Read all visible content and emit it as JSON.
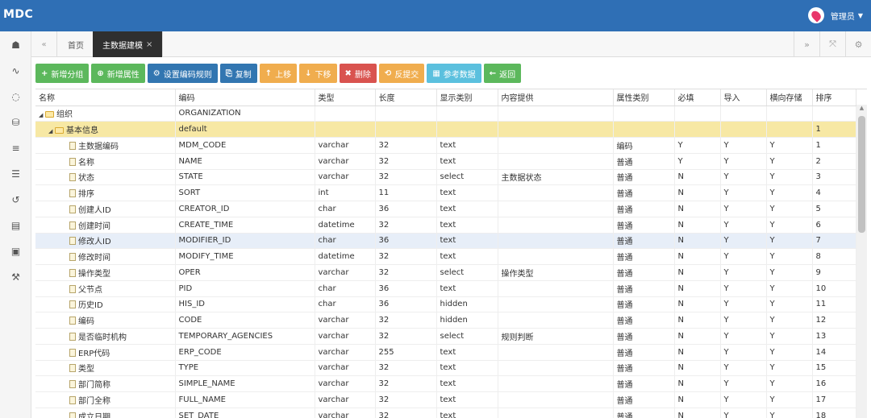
{
  "app": {
    "logo": "MDC",
    "user": "管理员"
  },
  "tabs": [
    {
      "label": "首页"
    },
    {
      "label": "主数据建模"
    }
  ],
  "tab_close": "×",
  "toolbar": [
    {
      "label": "新增分组",
      "icon": "+",
      "color": "#5cb85c"
    },
    {
      "label": "新增属性",
      "icon": "⊕",
      "color": "#5cb85c"
    },
    {
      "label": "设置编码规则",
      "icon": "⚙",
      "color": "#3276b1"
    },
    {
      "label": "复制",
      "icon": "⎘",
      "color": "#3276b1"
    },
    {
      "label": "上移",
      "icon": "↑",
      "color": "#f0ad4e"
    },
    {
      "label": "下移",
      "icon": "↓",
      "color": "#f0ad4e"
    },
    {
      "label": "删除",
      "icon": "✖",
      "color": "#d9534f"
    },
    {
      "label": "反提交",
      "icon": "⟲",
      "color": "#f0ad4e"
    },
    {
      "label": "参考数据",
      "icon": "▦",
      "color": "#5bc0de"
    },
    {
      "label": "返回",
      "icon": "←",
      "color": "#5cb85c"
    }
  ],
  "columns": [
    "名称",
    "编码",
    "类型",
    "长度",
    "显示类别",
    "内容提供",
    "属性类别",
    "必填",
    "导入",
    "横向存储",
    "排序"
  ],
  "rows": [
    {
      "level": 0,
      "kind": "folder",
      "cells": [
        "组织",
        "ORGANIZATION",
        "",
        "",
        "",
        "",
        "",
        "",
        "",
        "",
        ""
      ]
    },
    {
      "level": 1,
      "kind": "folder",
      "cells": [
        "基本信息",
        "default",
        "",
        "",
        "",
        "",
        "",
        "",
        "",
        "",
        "1"
      ]
    },
    {
      "level": 2,
      "kind": "file",
      "cells": [
        "主数据编码",
        "MDM_CODE",
        "varchar",
        "32",
        "text",
        "",
        "编码",
        "Y",
        "Y",
        "Y",
        "1"
      ]
    },
    {
      "level": 2,
      "kind": "file",
      "cells": [
        "名称",
        "NAME",
        "varchar",
        "32",
        "text",
        "",
        "普通",
        "Y",
        "Y",
        "Y",
        "2"
      ]
    },
    {
      "level": 2,
      "kind": "file",
      "cells": [
        "状态",
        "STATE",
        "varchar",
        "32",
        "select",
        "主数据状态",
        "普通",
        "N",
        "Y",
        "Y",
        "3"
      ]
    },
    {
      "level": 2,
      "kind": "file",
      "cells": [
        "排序",
        "SORT",
        "int",
        "11",
        "text",
        "",
        "普通",
        "N",
        "Y",
        "Y",
        "4"
      ]
    },
    {
      "level": 2,
      "kind": "file",
      "cells": [
        "创建人ID",
        "CREATOR_ID",
        "char",
        "36",
        "text",
        "",
        "普通",
        "N",
        "Y",
        "Y",
        "5"
      ]
    },
    {
      "level": 2,
      "kind": "file",
      "cells": [
        "创建时间",
        "CREATE_TIME",
        "datetime",
        "32",
        "text",
        "",
        "普通",
        "N",
        "Y",
        "Y",
        "6"
      ]
    },
    {
      "level": 2,
      "kind": "file",
      "cells": [
        "修改人ID",
        "MODIFIER_ID",
        "char",
        "36",
        "text",
        "",
        "普通",
        "N",
        "Y",
        "Y",
        "7"
      ]
    },
    {
      "level": 2,
      "kind": "file",
      "cells": [
        "修改时间",
        "MODIFY_TIME",
        "datetime",
        "32",
        "text",
        "",
        "普通",
        "N",
        "Y",
        "Y",
        "8"
      ]
    },
    {
      "level": 2,
      "kind": "file",
      "cells": [
        "操作类型",
        "OPER",
        "varchar",
        "32",
        "select",
        "操作类型",
        "普通",
        "N",
        "Y",
        "Y",
        "9"
      ]
    },
    {
      "level": 2,
      "kind": "file",
      "cells": [
        "父节点",
        "PID",
        "char",
        "36",
        "text",
        "",
        "普通",
        "N",
        "Y",
        "Y",
        "10"
      ]
    },
    {
      "level": 2,
      "kind": "file",
      "cells": [
        "历史ID",
        "HIS_ID",
        "char",
        "36",
        "hidden",
        "",
        "普通",
        "N",
        "Y",
        "Y",
        "11"
      ]
    },
    {
      "level": 2,
      "kind": "file",
      "cells": [
        "编码",
        "CODE",
        "varchar",
        "32",
        "hidden",
        "",
        "普通",
        "N",
        "Y",
        "Y",
        "12"
      ]
    },
    {
      "level": 2,
      "kind": "file",
      "cells": [
        "是否临时机构",
        "TEMPORARY_AGENCIES",
        "varchar",
        "32",
        "select",
        "规则判断",
        "普通",
        "N",
        "Y",
        "Y",
        "13"
      ]
    },
    {
      "level": 2,
      "kind": "file",
      "cells": [
        "ERP代码",
        "ERP_CODE",
        "varchar",
        "255",
        "text",
        "",
        "普通",
        "N",
        "Y",
        "Y",
        "14"
      ]
    },
    {
      "level": 2,
      "kind": "file",
      "cells": [
        "类型",
        "TYPE",
        "varchar",
        "32",
        "text",
        "",
        "普通",
        "N",
        "Y",
        "Y",
        "15"
      ]
    },
    {
      "level": 2,
      "kind": "file",
      "cells": [
        "部门简称",
        "SIMPLE_NAME",
        "varchar",
        "32",
        "text",
        "",
        "普通",
        "N",
        "Y",
        "Y",
        "16"
      ]
    },
    {
      "level": 2,
      "kind": "file",
      "cells": [
        "部门全称",
        "FULL_NAME",
        "varchar",
        "32",
        "text",
        "",
        "普通",
        "N",
        "Y",
        "Y",
        "17"
      ]
    },
    {
      "level": 2,
      "kind": "file",
      "cells": [
        "成立日期",
        "SET_DATE",
        "varchar",
        "32",
        "text",
        "",
        "普通",
        "N",
        "Y",
        "Y",
        "18"
      ]
    }
  ],
  "highlight": {
    "group_row": 1,
    "hover_row": 8
  },
  "colors": {
    "topbar": "#2f6fb5",
    "group_row": "#f7e8a4",
    "hover_row": "#e7eef8",
    "avatar": "#e8366a"
  }
}
